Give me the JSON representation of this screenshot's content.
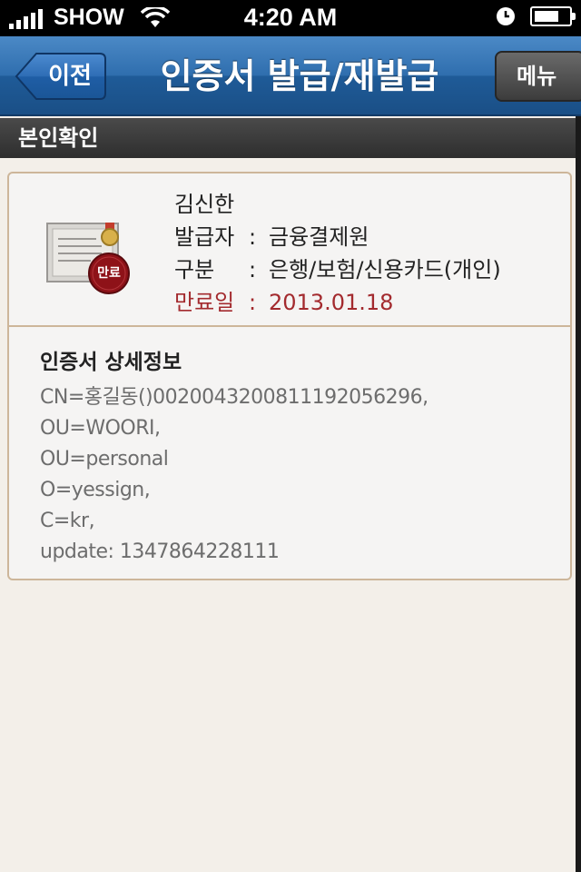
{
  "status_bar": {
    "carrier": "SHOW",
    "time": "4:20 AM"
  },
  "navbar": {
    "back_label": "이전",
    "title": "인증서 발급/재발급",
    "menu_label": "메뉴"
  },
  "section": {
    "title": "본인확인"
  },
  "certificate": {
    "badge_label": "만료",
    "name": "김신한",
    "issuer_label": "발급자",
    "issuer_value": "금융결제원",
    "type_label": "구분",
    "type_value": "은행/보험/신용카드(개인)",
    "expiry_label": "만료일",
    "expiry_value": "2013.01.18",
    "separator": ":"
  },
  "details": {
    "title": "인증서 상세정보",
    "lines": [
      "CN=홍길동()0020043200811192056296,",
      "OU=WOORI,",
      "OU=personal",
      "O=yessign,",
      "C=kr,",
      "update: 1347864228111"
    ]
  },
  "icons": {
    "signal": "signal-bars-icon",
    "wifi": "wifi-icon",
    "clock": "clock-icon",
    "battery": "battery-icon",
    "certificate": "certificate-icon",
    "expired_badge": "expired-badge-icon"
  },
  "colors": {
    "nav_blue": "#2f6eae",
    "expiry_red": "#a32a2e",
    "card_border": "#cdb69a"
  }
}
